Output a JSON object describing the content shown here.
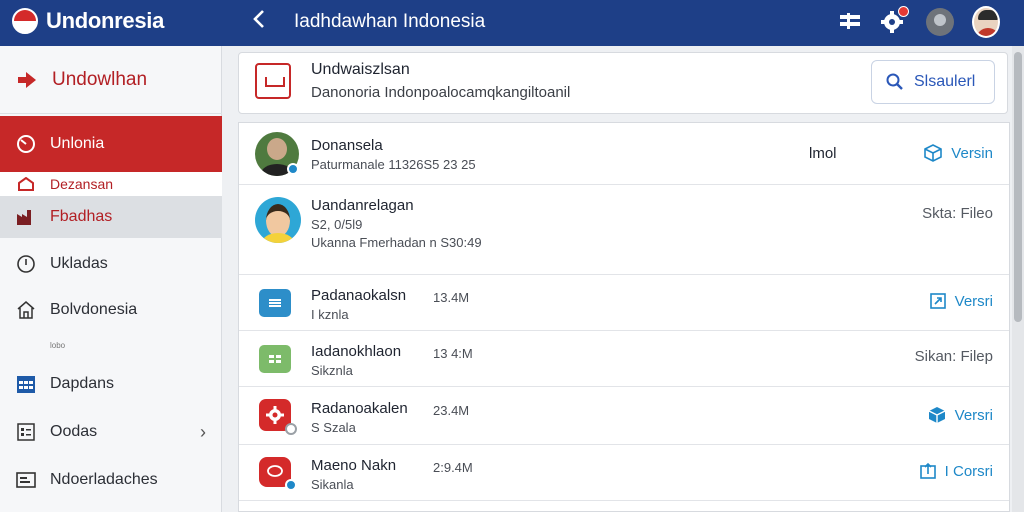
{
  "topbar": {
    "brand": "Undonresia",
    "title": "Iadhdawhan Indonesia",
    "colors": {
      "bar": "#1e3f87",
      "accent": "#c62828"
    }
  },
  "sidebar": {
    "header": "Undowlhan",
    "items": [
      {
        "label": "Unlonia",
        "icon": "gauge-icon"
      },
      {
        "label": "Dezansan",
        "icon": "home-icon"
      },
      {
        "label": "Fbadhas",
        "icon": "factory-icon"
      },
      {
        "label": "Ukladas",
        "icon": "clock-icon"
      },
      {
        "label": "Bolvdonesia",
        "icon": "house-icon"
      },
      {
        "label": "Dapdans",
        "icon": "calendar-icon"
      },
      {
        "label": "Oodas",
        "icon": "list-icon"
      },
      {
        "label": "Ndoerladaches",
        "icon": "card-icon"
      }
    ],
    "tiny_text": "lobo"
  },
  "header_card": {
    "title": "Undwaiszlsan",
    "subtitle": "Danonoria Indonpoalocamqkangiltoanil",
    "search_label": "Slsaulerl"
  },
  "rows": [
    {
      "name": "Donansela",
      "meta": "Paturmanale 11326S5 23 25",
      "flag": "lmol",
      "action": "Versin"
    },
    {
      "name": "Uandanrelagan",
      "meta": "S2, 0/5l9",
      "meta2": "Ukanna Fmerhadan n S30:49",
      "action": "Skta: Fileo"
    },
    {
      "name": "Padanaokalsn",
      "size": "13.4M",
      "meta": "I kznla",
      "action": "Versri"
    },
    {
      "name": "Iadanokhlaon",
      "size": "13 4:M",
      "meta": "Sikznla",
      "action": "Sikan: Filep"
    },
    {
      "name": "Radanoakalen",
      "size": "23.4M",
      "meta": "S Szala",
      "action": "Versri"
    },
    {
      "name": "Maeno Nakn",
      "size": "2:9.4M",
      "meta": "Sikanla",
      "action": "I Corsri"
    }
  ]
}
